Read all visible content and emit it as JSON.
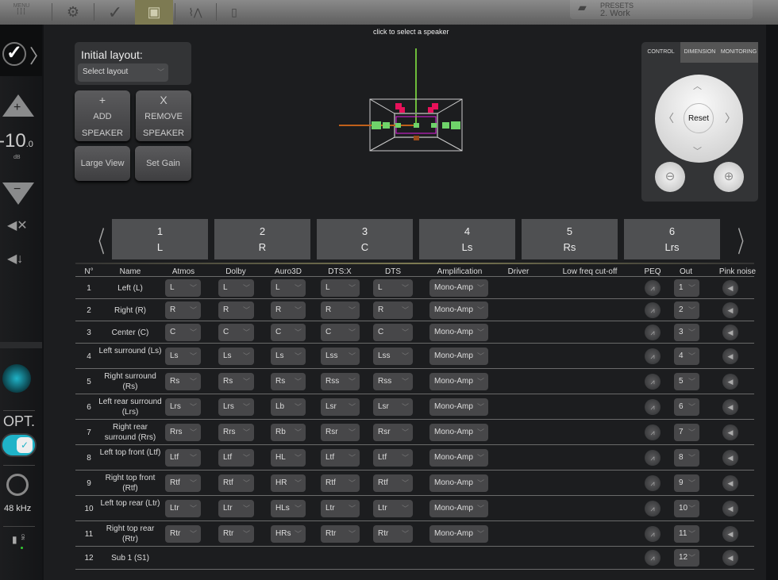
{
  "topbar": {
    "menu_label": "MENU",
    "presets_label": "PRESETS",
    "preset_value": "2. Work",
    "icons": [
      "menu-grid-icon",
      "gear-icon",
      "checkmark-icon",
      "room-layout-icon",
      "eq-curve-icon",
      "microphone-icon"
    ],
    "active_color": "#7d7a52"
  },
  "sidebar": {
    "volume": "-10",
    "volume_decimal": ".0",
    "volume_unit": "dB",
    "input_label": "OPT.",
    "sample_rate": "48 kHz",
    "mic_status": "ON",
    "accent": "#1fb3c8"
  },
  "layout_panel": {
    "title": "Initial layout:",
    "select_value": "Select layout",
    "add_symbol": "+",
    "add_line1": "ADD",
    "add_line2": "SPEAKER",
    "remove_symbol": "X",
    "remove_line1": "REMOVE",
    "remove_line2": "SPEAKER",
    "large_view": "Large View",
    "set_gain": "Set Gain"
  },
  "viewer": {
    "hint": "click to select a speaker"
  },
  "control_panel": {
    "tabs": [
      "CONTROL",
      "DIMENSION",
      "MONITORING"
    ],
    "active_tab": "CONTROL",
    "reset": "Reset"
  },
  "speaker_tabs": [
    {
      "num": "1",
      "code": "L"
    },
    {
      "num": "2",
      "code": "R"
    },
    {
      "num": "3",
      "code": "C"
    },
    {
      "num": "4",
      "code": "Ls"
    },
    {
      "num": "5",
      "code": "Rs"
    },
    {
      "num": "6",
      "code": "Lrs"
    }
  ],
  "table": {
    "headers": [
      "N°",
      "Name",
      "Atmos",
      "Dolby",
      "Auro3D",
      "DTS:X",
      "DTS",
      "Amplification",
      "Driver",
      "Low freq cut-off",
      "PEQ",
      "Out",
      "Pink noise"
    ],
    "rows": [
      {
        "n": "1",
        "name": "Left (L)",
        "atmos": "L",
        "dolby": "L",
        "auro": "L",
        "dtsx": "L",
        "dts": "L",
        "amp": "Mono-Amp",
        "out": "1"
      },
      {
        "n": "2",
        "name": "Right (R)",
        "atmos": "R",
        "dolby": "R",
        "auro": "R",
        "dtsx": "R",
        "dts": "R",
        "amp": "Mono-Amp",
        "out": "2"
      },
      {
        "n": "3",
        "name": "Center (C)",
        "atmos": "C",
        "dolby": "C",
        "auro": "C",
        "dtsx": "C",
        "dts": "C",
        "amp": "Mono-Amp",
        "out": "3"
      },
      {
        "n": "4",
        "name": "Left surround (Ls)",
        "atmos": "Ls",
        "dolby": "Ls",
        "auro": "Ls",
        "dtsx": "Lss",
        "dts": "Lss",
        "amp": "Mono-Amp",
        "out": "4"
      },
      {
        "n": "5",
        "name": "Right surround (Rs)",
        "atmos": "Rs",
        "dolby": "Rs",
        "auro": "Rs",
        "dtsx": "Rss",
        "dts": "Rss",
        "amp": "Mono-Amp",
        "out": "5"
      },
      {
        "n": "6",
        "name": "Left rear surround (Lrs)",
        "atmos": "Lrs",
        "dolby": "Lrs",
        "auro": "Lb",
        "dtsx": "Lsr",
        "dts": "Lsr",
        "amp": "Mono-Amp",
        "out": "6"
      },
      {
        "n": "7",
        "name": "Right rear surround (Rrs)",
        "atmos": "Rrs",
        "dolby": "Rrs",
        "auro": "Rb",
        "dtsx": "Rsr",
        "dts": "Rsr",
        "amp": "Mono-Amp",
        "out": "7"
      },
      {
        "n": "8",
        "name": "Left top front (Ltf)",
        "atmos": "Ltf",
        "dolby": "Ltf",
        "auro": "HL",
        "dtsx": "Ltf",
        "dts": "Ltf",
        "amp": "Mono-Amp",
        "out": "8"
      },
      {
        "n": "9",
        "name": "Right top front (Rtf)",
        "atmos": "Rtf",
        "dolby": "Rtf",
        "auro": "HR",
        "dtsx": "Rtf",
        "dts": "Rtf",
        "amp": "Mono-Amp",
        "out": "9"
      },
      {
        "n": "10",
        "name": "Left top rear (Ltr)",
        "atmos": "Ltr",
        "dolby": "Ltr",
        "auro": "HLs",
        "dtsx": "Ltr",
        "dts": "Ltr",
        "amp": "Mono-Amp",
        "out": "10"
      },
      {
        "n": "11",
        "name": "Right top rear (Rtr)",
        "atmos": "Rtr",
        "dolby": "Rtr",
        "auro": "HRs",
        "dtsx": "Rtr",
        "dts": "Rtr",
        "amp": "Mono-Amp",
        "out": "11"
      },
      {
        "n": "12",
        "name": "Sub 1 (S1)",
        "out": "12"
      }
    ]
  }
}
